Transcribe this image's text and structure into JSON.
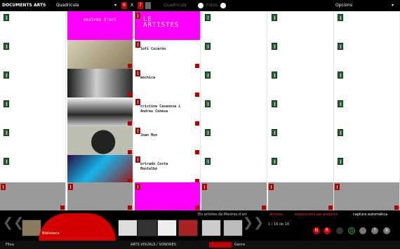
{
  "topbar": {
    "title": "DOCUMENTS ARTS",
    "view": "Quadricula",
    "grid_cols": "6",
    "grid_sep": "X",
    "grid_rows": "7",
    "option_a": "Quadricula",
    "option_b": "Fotos",
    "options_label": "Opcions",
    "options_arrow": "▾",
    "view_arrow": "▾"
  },
  "column3": {
    "header": "mestres d'art",
    "thumb_labels": []
  },
  "column4": {
    "brand": "LE\nARTISTES",
    "artists": [
      "lofi Cucarón",
      "mochica",
      "cristine Casanova i\nAndreu Conésa",
      "Joan Mon",
      "ortrado Costa\nMontalbo"
    ]
  },
  "bottom": {
    "breadcrumb": "Els artistes de Mestres d'art",
    "link_red": "Artistes",
    "link_red2": "exposicions per projecte",
    "link_white": "captura automàtica",
    "pager": "1 / 16 de 16",
    "tooltip_label": "Biblioteca",
    "controls": [
      "N",
      "R",
      "",
      "D",
      "",
      "?",
      "X"
    ]
  },
  "bottombar": {
    "left": "Fitxa",
    "middle": "ARTS VISUALS / SONORES",
    "right": "Genre"
  }
}
